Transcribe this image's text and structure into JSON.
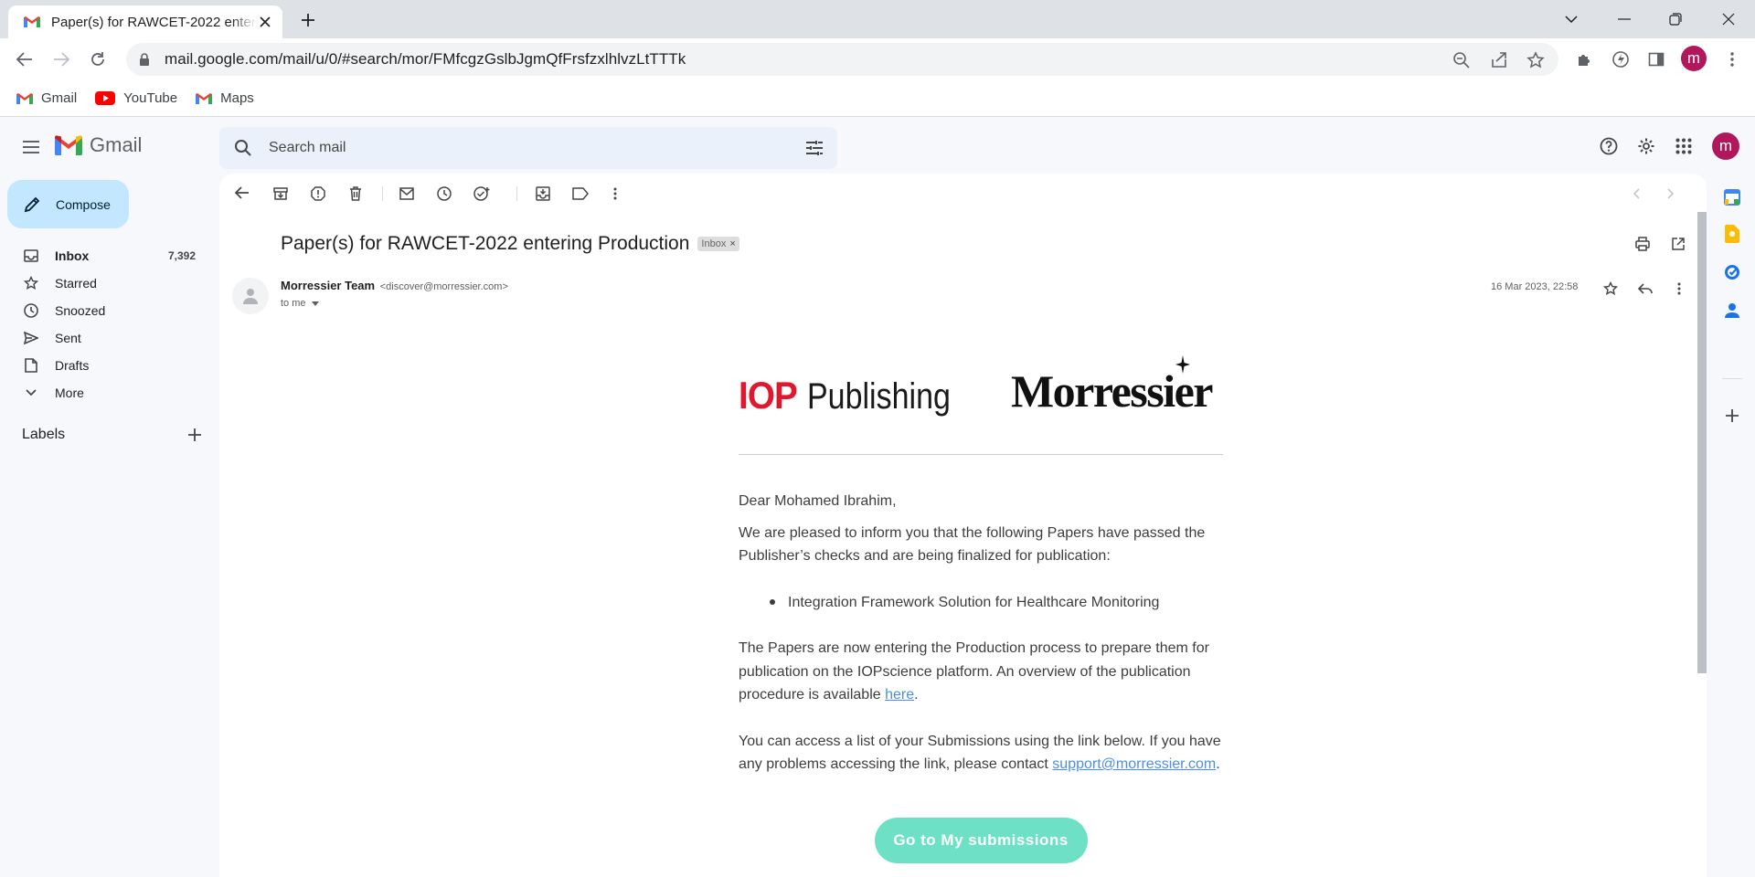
{
  "browser": {
    "tab_title": "Paper(s) for RAWCET-2022 entering Production - Gmail",
    "url": "mail.google.com/mail/u/0/#search/mor/FMfcgzGslbJgmQfFrsfzxlhlvzLtTTTk",
    "profile_initial": "m",
    "bookmarks": [
      {
        "label": "Gmail",
        "icon": "gmail-icon"
      },
      {
        "label": "YouTube",
        "icon": "youtube-icon"
      },
      {
        "label": "Maps",
        "icon": "maps-icon"
      }
    ]
  },
  "gmail": {
    "app_name": "Gmail",
    "search_placeholder": "Search mail",
    "avatar_initial": "m",
    "compose_label": "Compose",
    "nav": [
      {
        "label": "Inbox",
        "count": "7,392",
        "icon": "inbox-icon"
      },
      {
        "label": "Starred",
        "count": "",
        "icon": "star-icon"
      },
      {
        "label": "Snoozed",
        "count": "",
        "icon": "clock-icon"
      },
      {
        "label": "Sent",
        "count": "",
        "icon": "send-icon"
      },
      {
        "label": "Drafts",
        "count": "",
        "icon": "draft-icon"
      },
      {
        "label": "More",
        "count": "",
        "icon": "chevron-down-icon"
      }
    ],
    "labels_heading": "Labels"
  },
  "email": {
    "subject": "Paper(s) for RAWCET-2022 entering Production",
    "label_badge": "Inbox",
    "sender_name": "Morressier Team",
    "sender_email": "<discover@morressier.com>",
    "recipient": "to me",
    "date": "16 Mar 2023, 22:58",
    "body": {
      "logo_iop_mark": "IOP",
      "logo_iop_word": "Publishing",
      "logo_morressier": "Morressier",
      "greeting": "Dear Mohamed Ibrahim,",
      "para1": "We are pleased to inform you that the following Papers have passed the Publisher’s checks and are being finalized for publication:",
      "bullet": "Integration Framework Solution for Healthcare Monitoring",
      "para2": "The Papers are now entering the Production process to prepare them for publication on the IOPscience platform. An overview of the publication procedure is available ",
      "para2_link": "here",
      "para2_end": ".",
      "para3": "You can access a list of your Submissions using the link below. If you have any problems accessing the link, please contact ",
      "para3_link": "support@morressier.com",
      "para3_end": ".",
      "cta": "Go to My submissions"
    }
  },
  "colors": {
    "accent": "#0b57d0",
    "compose_bg": "#c2e7ff",
    "iop_red": "#e0182d",
    "cta": "#6ee0c6",
    "link": "#4a90e2",
    "avatar": "#b0185b"
  }
}
